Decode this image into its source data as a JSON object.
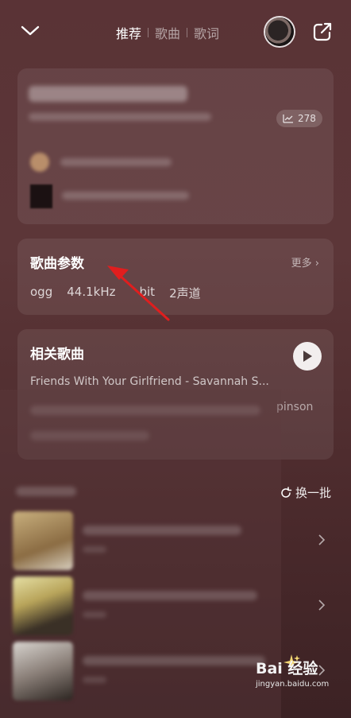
{
  "header": {
    "tabs": [
      {
        "label": "推荐",
        "active": true
      },
      {
        "label": "歌曲",
        "active": false
      },
      {
        "label": "歌词",
        "active": false
      }
    ]
  },
  "song_card": {
    "play_count": "278"
  },
  "params_card": {
    "title": "歌曲参数",
    "more_label": "更多",
    "params": [
      "ogg",
      "44.1kHz",
      "bit",
      "2声道"
    ]
  },
  "related_card": {
    "title": "相关歌曲",
    "songs": [
      "Friends With Your Girlfriend - Savannah S...",
      "pinson"
    ]
  },
  "recommend": {
    "refresh_label": "换一批"
  },
  "watermark": {
    "brand": "Bai  经验",
    "url": "jingyan.baidu.com"
  },
  "colors": {
    "accent_arrow": "#e01e1e",
    "background": "#5a3336"
  }
}
